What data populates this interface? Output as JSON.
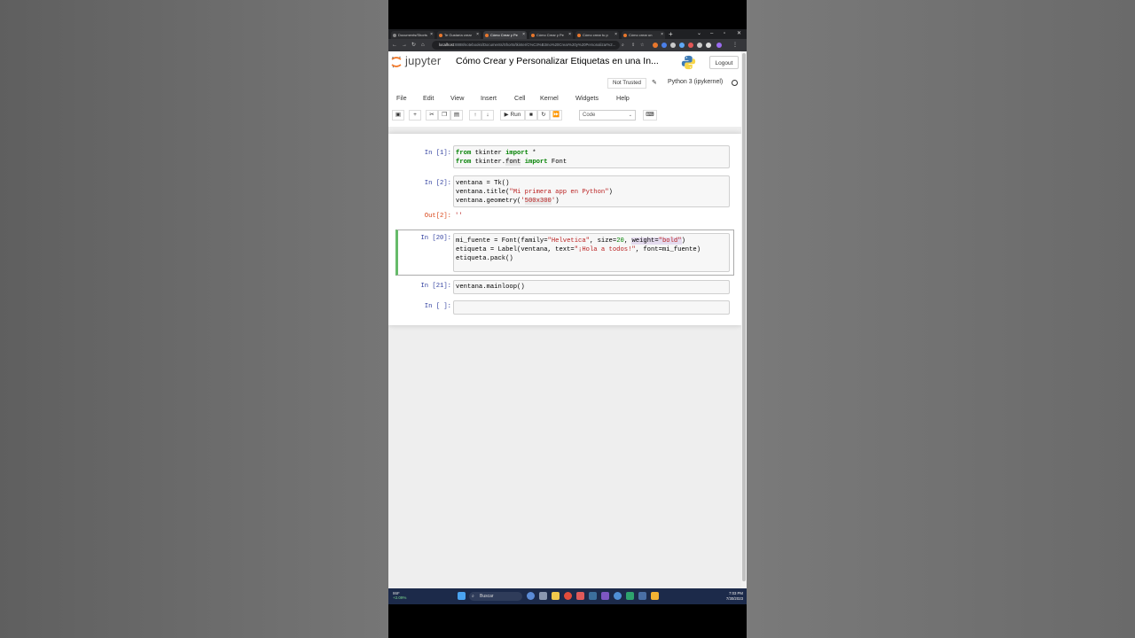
{
  "browser": {
    "tabs": [
      {
        "label": "Documents/Shorts"
      },
      {
        "label": "Te Gustaría crear"
      },
      {
        "label": "Cómo Crear y Pe"
      },
      {
        "label": "Cómo Crear y Pe"
      },
      {
        "label": "Cómo crear tu p"
      },
      {
        "label": "Cómo crear un"
      }
    ],
    "new_tab": "+",
    "url_host": "localhost",
    "url_path": ":8888/notebooks/Documents/Shorts/tkinter/C%C3%B3mo%20Crear%20y%20Personalizar%2..."
  },
  "header": {
    "logo_text": "jupyter",
    "notebook_title": "Cómo Crear y Personalizar Etiquetas en una In...",
    "logout_label": "Logout",
    "trust_label": "Not Trusted",
    "kernel_label": "Python 3 (ipykernel)"
  },
  "menu": {
    "items": [
      "File",
      "Edit",
      "View",
      "Insert",
      "Cell",
      "Kernel",
      "Widgets",
      "Help"
    ]
  },
  "toolbar": {
    "run_label": "Run",
    "cell_type": "Code"
  },
  "cells": [
    {
      "prompt": "In [1]:",
      "lines": [
        "from tkinter import *",
        "from tkinter.font import Font"
      ]
    },
    {
      "prompt": "In [2]:",
      "lines": [
        "ventana = Tk()",
        "ventana.title(\"Mi primera app en Python\")",
        "ventana.geometry('500x300')"
      ],
      "out_prompt": "Out[2]:",
      "output": "''"
    },
    {
      "prompt": "In [20]:",
      "lines": [
        "mi_fuente = Font(family=\"Helvetica\", size=20, weight=\"bold\")",
        "etiqueta = Label(ventana, text=\"¡Hola a todos!\", font=mi_fuente)",
        "etiqueta.pack()"
      ]
    },
    {
      "prompt": "In [21]:",
      "lines": [
        "ventana.mainloop()"
      ]
    },
    {
      "prompt": "In [ ]:",
      "lines": [
        ""
      ]
    }
  ],
  "taskbar": {
    "weather_temp": "86F",
    "weather_change": "+2.09%",
    "search_label": "Buscar",
    "time": "7:03 PM",
    "date": "7/30/2023"
  },
  "colors": {
    "prompt_in": "#303f9f",
    "prompt_out": "#d84315",
    "selected_cell_bar": "#66bb6a",
    "keyword": "#008000",
    "string": "#ba2121"
  }
}
